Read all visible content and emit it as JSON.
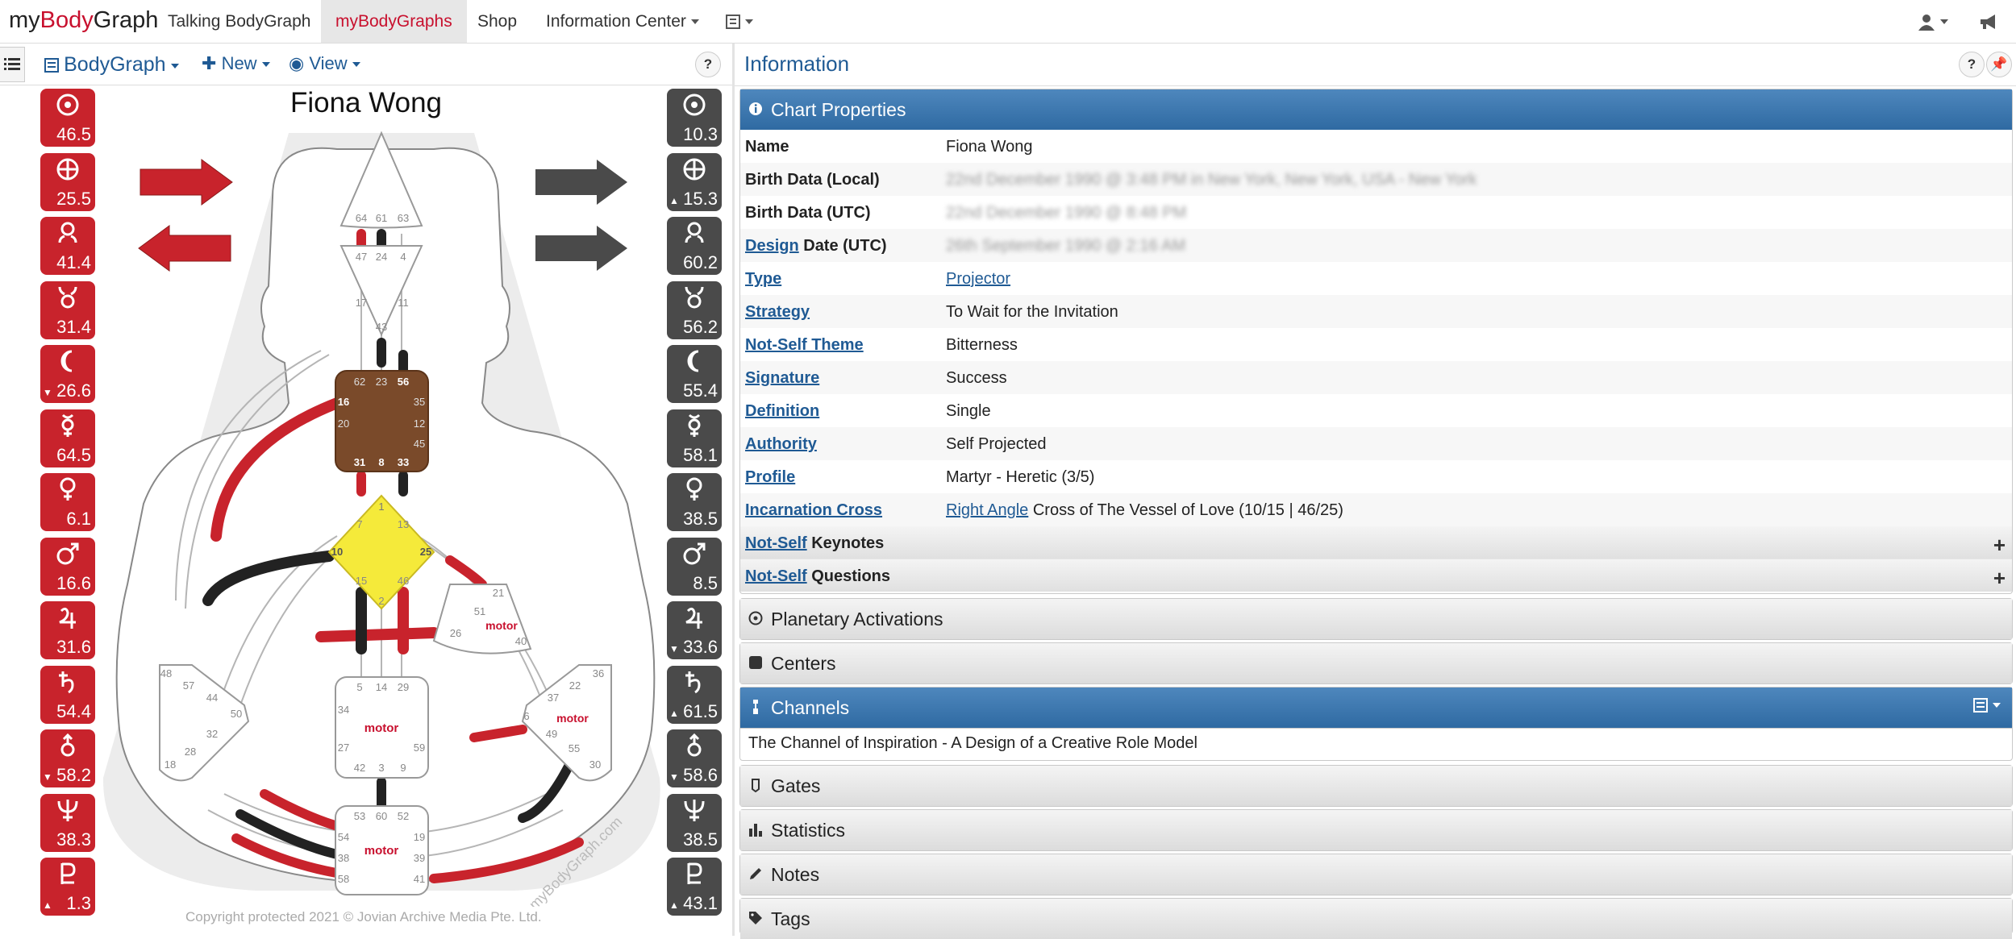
{
  "nav": {
    "brand_pre": "my",
    "brand_hl": "Body",
    "brand_post": "Graph",
    "items": [
      "Talking BodyGraph",
      "myBodyGraphs",
      "Shop",
      "Information Center"
    ]
  },
  "toolbar": {
    "bodygraph": "BodyGraph",
    "new": "New",
    "view": "View",
    "help": "?"
  },
  "chart": {
    "name": "Fiona Wong",
    "copyright": "Copyright protected 2021 © Jovian Archive Media Pte. Ltd.",
    "watermark": "myBodyGraph.com",
    "motor_label": "motor",
    "gates": {
      "head": [
        "64",
        "61",
        "63"
      ],
      "ajna": [
        "47",
        "24",
        "4",
        "17",
        "43",
        "11"
      ],
      "throat": [
        "62",
        "23",
        "56",
        "16",
        "35",
        "20",
        "12",
        "31",
        "8",
        "33",
        "45"
      ],
      "g": [
        "1",
        "7",
        "13",
        "10",
        "25",
        "15",
        "46",
        "2"
      ],
      "heart": [
        "21",
        "51",
        "26",
        "40"
      ],
      "sacral": [
        "5",
        "14",
        "29",
        "34",
        "27",
        "59",
        "42",
        "3",
        "9"
      ],
      "spleen": [
        "48",
        "57",
        "44",
        "50",
        "32",
        "28",
        "18"
      ],
      "solar": [
        "36",
        "22",
        "37",
        "6",
        "49",
        "55",
        "30"
      ],
      "root": [
        "53",
        "60",
        "52",
        "54",
        "19",
        "38",
        "39",
        "58",
        "41"
      ]
    }
  },
  "personality": [
    {
      "icon": "sun-icon",
      "value": "46.5"
    },
    {
      "icon": "earth-icon",
      "value": "25.5"
    },
    {
      "icon": "north-node-icon",
      "value": "41.4"
    },
    {
      "icon": "south-node-icon",
      "value": "31.4"
    },
    {
      "icon": "moon-icon",
      "value": "26.6",
      "mark": "▼"
    },
    {
      "icon": "mercury-icon",
      "value": "64.5"
    },
    {
      "icon": "venus-icon",
      "value": "6.1"
    },
    {
      "icon": "mars-icon",
      "value": "16.6"
    },
    {
      "icon": "jupiter-icon",
      "value": "31.6"
    },
    {
      "icon": "saturn-icon",
      "value": "54.4"
    },
    {
      "icon": "uranus-icon",
      "value": "58.2",
      "mark": "▼"
    },
    {
      "icon": "neptune-icon",
      "value": "38.3"
    },
    {
      "icon": "pluto-icon",
      "value": "1.3",
      "mark": "▲"
    }
  ],
  "design": [
    {
      "icon": "sun-icon",
      "value": "10.3"
    },
    {
      "icon": "earth-icon",
      "value": "15.3",
      "mark": "▲"
    },
    {
      "icon": "north-node-icon",
      "value": "60.2"
    },
    {
      "icon": "south-node-icon",
      "value": "56.2"
    },
    {
      "icon": "moon-icon",
      "value": "55.4"
    },
    {
      "icon": "mercury-icon",
      "value": "58.1"
    },
    {
      "icon": "venus-icon",
      "value": "38.5"
    },
    {
      "icon": "mars-icon",
      "value": "8.5"
    },
    {
      "icon": "jupiter-icon",
      "value": "33.6",
      "mark": "▼"
    },
    {
      "icon": "saturn-icon",
      "value": "61.5",
      "mark": "▲"
    },
    {
      "icon": "uranus-icon",
      "value": "58.6",
      "mark": "▼"
    },
    {
      "icon": "neptune-icon",
      "value": "38.5"
    },
    {
      "icon": "pluto-icon",
      "value": "43.1",
      "mark": "▲"
    }
  ],
  "info": {
    "title": "Information",
    "chart_properties": "Chart Properties",
    "rows": [
      {
        "key": "Name",
        "value": "Fiona Wong"
      },
      {
        "key": "Birth Data (Local)",
        "value": "22nd December 1990 @ 3:48 PM in New York, New York, USA - New York"
      },
      {
        "key": "Birth Data (UTC)",
        "value": "22nd December 1990 @ 8:48 PM"
      },
      {
        "key_link": "Design",
        "key_rest": " Date (UTC)",
        "value": "26th September 1990 @ 2:16 AM"
      },
      {
        "key": "Type",
        "value_link": "Projector"
      },
      {
        "key": "Strategy",
        "value": "To Wait for the Invitation"
      },
      {
        "key": "Not-Self Theme",
        "value": "Bitterness"
      },
      {
        "key": "Signature",
        "value": "Success"
      },
      {
        "key": "Definition",
        "value": "Single"
      },
      {
        "key": "Authority",
        "value": "Self Projected"
      },
      {
        "key": "Profile",
        "value": "Martyr - Heretic (3/5)"
      },
      {
        "key": "Incarnation Cross",
        "value_link": "Right Angle",
        "value": " Cross of The Vessel of Love (10/15 | 46/25)"
      }
    ],
    "keynotes_link": "Not-Self",
    "keynotes_rest": " Keynotes",
    "questions_link": "Not-Self",
    "questions_rest": " Questions",
    "planetary": "Planetary Activations",
    "centers": "Centers",
    "channels": "Channels",
    "channel_item": "The Channel of Inspiration - A Design of a Creative Role Model",
    "gates": "Gates",
    "statistics": "Statistics",
    "notes": "Notes",
    "tags": "Tags"
  },
  "colors": {
    "personality": "#c8232c",
    "design": "#4a4a4a",
    "accent": "#1f5a94",
    "throat": "#7a4a2a",
    "g_center": "#f5ea3a"
  }
}
